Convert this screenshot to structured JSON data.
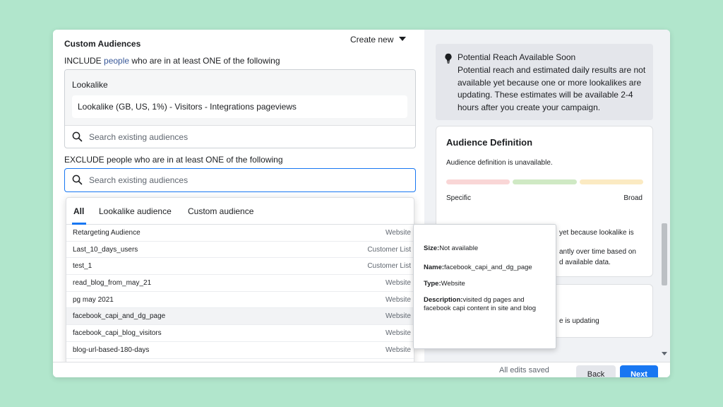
{
  "left": {
    "section_title": "Custom Audiences",
    "create_new": "Create new",
    "include_prefix": "INCLUDE ",
    "include_link": "people",
    "include_suffix": " who are in at least ONE of the following",
    "include_box": {
      "label": "Lookalike",
      "selected": "Lookalike (GB, US, 1%) - Visitors - Integrations pageviews",
      "search_placeholder": "Search existing audiences"
    },
    "exclude_text": "EXCLUDE people who are in at least ONE of the following",
    "exclude_search_placeholder": "Search existing audiences"
  },
  "dropdown": {
    "tabs": [
      "All",
      "Lookalike audience",
      "Custom audience"
    ],
    "rows": [
      {
        "name": "Retargeting Audience",
        "type": "Website"
      },
      {
        "name": "Last_10_days_users",
        "type": "Customer List"
      },
      {
        "name": "test_1",
        "type": "Customer List"
      },
      {
        "name": "read_blog_from_may_21",
        "type": "Website"
      },
      {
        "name": "pg may 2021",
        "type": "Website"
      },
      {
        "name": "facebook_capi_and_dg_page",
        "type": "Website"
      },
      {
        "name": "facebook_capi_blog_visitors",
        "type": "Website"
      },
      {
        "name": "blog-url-based-180-days",
        "type": "Website"
      }
    ]
  },
  "tooltip": {
    "size_label": "Size:",
    "size_value": "Not available",
    "name_label": "Name:",
    "name_value": "facebook_capi_and_dg_page",
    "type_label": "Type:",
    "type_value": "Website",
    "desc_label": "Description:",
    "desc_value": "visited dg pages and facebook capi content in site and blog"
  },
  "right": {
    "reach_title": "Potential Reach Available Soon",
    "reach_body": "Potential reach and estimated daily results are not available yet because one or more lookalikes are updating. These estimates will be available 2-4 hours after you create your campaign.",
    "def_title": "Audience Definition",
    "def_sub": "Audience definition is unavailable.",
    "specific": "Specific",
    "broad": "Broad",
    "frag1": "yet because lookalike is",
    "frag2": "antly over time based on",
    "frag3": "d available data.",
    "frag4": "e is updating"
  },
  "bottom": {
    "status": "All edits saved",
    "back": "Back",
    "next": "Next"
  },
  "colors": {
    "accent": "#1877f2",
    "meter_specific": "#f9d6d6",
    "meter_mid": "#cfe9c4",
    "meter_broad": "#fbeac2"
  }
}
